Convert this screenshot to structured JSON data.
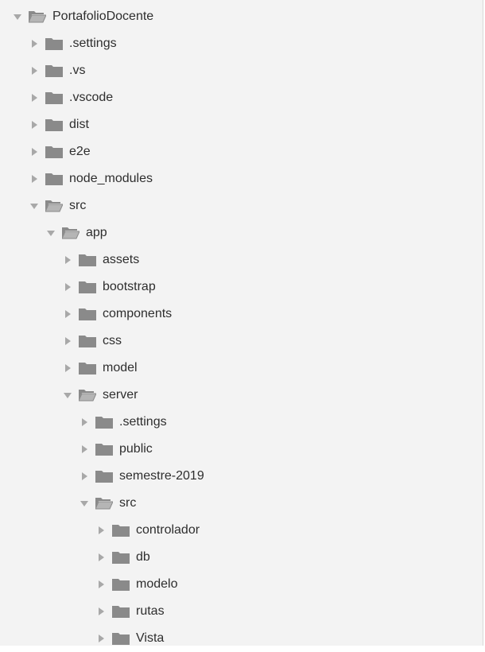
{
  "colors": {
    "panel_bg": "#f3f3f3",
    "folder_fill": "#8a8a8a",
    "twisty": "#a8a8a8",
    "text": "#2e2e2e"
  },
  "tree": {
    "items": [
      {
        "label": "PortafolioDocente",
        "depth": 0,
        "expanded": true
      },
      {
        "label": ".settings",
        "depth": 1,
        "expanded": false
      },
      {
        "label": ".vs",
        "depth": 1,
        "expanded": false
      },
      {
        "label": ".vscode",
        "depth": 1,
        "expanded": false
      },
      {
        "label": "dist",
        "depth": 1,
        "expanded": false
      },
      {
        "label": "e2e",
        "depth": 1,
        "expanded": false
      },
      {
        "label": "node_modules",
        "depth": 1,
        "expanded": false
      },
      {
        "label": "src",
        "depth": 1,
        "expanded": true
      },
      {
        "label": "app",
        "depth": 2,
        "expanded": true
      },
      {
        "label": "assets",
        "depth": 3,
        "expanded": false
      },
      {
        "label": "bootstrap",
        "depth": 3,
        "expanded": false
      },
      {
        "label": "components",
        "depth": 3,
        "expanded": false
      },
      {
        "label": "css",
        "depth": 3,
        "expanded": false
      },
      {
        "label": "model",
        "depth": 3,
        "expanded": false
      },
      {
        "label": "server",
        "depth": 3,
        "expanded": true
      },
      {
        "label": ".settings",
        "depth": 4,
        "expanded": false
      },
      {
        "label": "public",
        "depth": 4,
        "expanded": false
      },
      {
        "label": "semestre-2019",
        "depth": 4,
        "expanded": false
      },
      {
        "label": "src",
        "depth": 4,
        "expanded": true
      },
      {
        "label": "controlador",
        "depth": 5,
        "expanded": false
      },
      {
        "label": "db",
        "depth": 5,
        "expanded": false
      },
      {
        "label": "modelo",
        "depth": 5,
        "expanded": false
      },
      {
        "label": "rutas",
        "depth": 5,
        "expanded": false
      },
      {
        "label": "Vista",
        "depth": 5,
        "expanded": false
      }
    ]
  }
}
